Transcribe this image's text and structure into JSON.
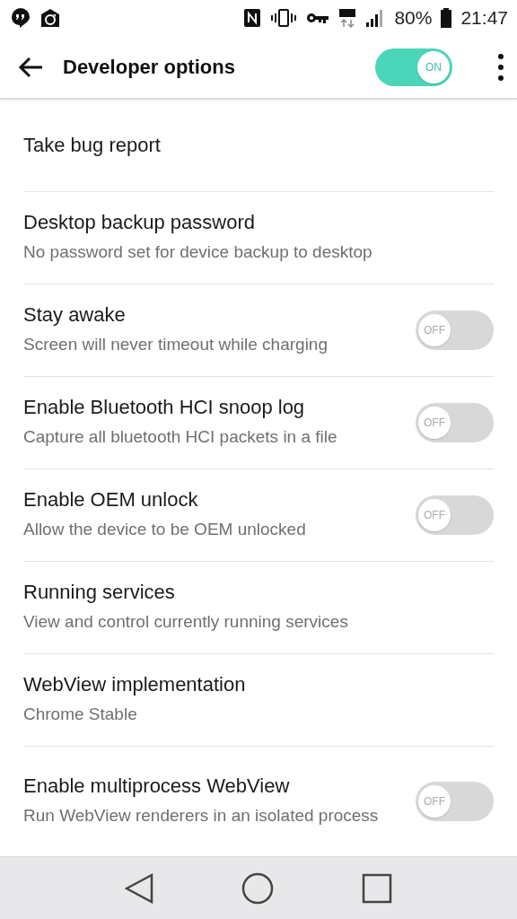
{
  "status_bar": {
    "battery": "80%",
    "time": "21:47"
  },
  "toolbar": {
    "title": "Developer options",
    "master_switch": {
      "on": true,
      "label": "ON"
    }
  },
  "settings": [
    {
      "title": "Take bug report"
    },
    {
      "title": "Desktop backup password",
      "summary": "No password set for device backup to desktop"
    },
    {
      "title": "Stay awake",
      "summary": "Screen will never timeout while charging",
      "switch": {
        "on": false,
        "label": "OFF"
      }
    },
    {
      "title": "Enable Bluetooth HCI snoop log",
      "summary": "Capture all bluetooth HCI packets in a file",
      "switch": {
        "on": false,
        "label": "OFF"
      }
    },
    {
      "title": "Enable OEM unlock",
      "summary": "Allow the device to be OEM unlocked",
      "switch": {
        "on": false,
        "label": "OFF"
      }
    },
    {
      "title": "Running services",
      "summary": "View and control currently running services"
    },
    {
      "title": "WebView implementation",
      "summary": "Chrome Stable"
    },
    {
      "title": "Enable multiprocess WebView",
      "summary": "Run WebView renderers in an isolated process",
      "switch": {
        "on": false,
        "label": "OFF"
      }
    }
  ]
}
